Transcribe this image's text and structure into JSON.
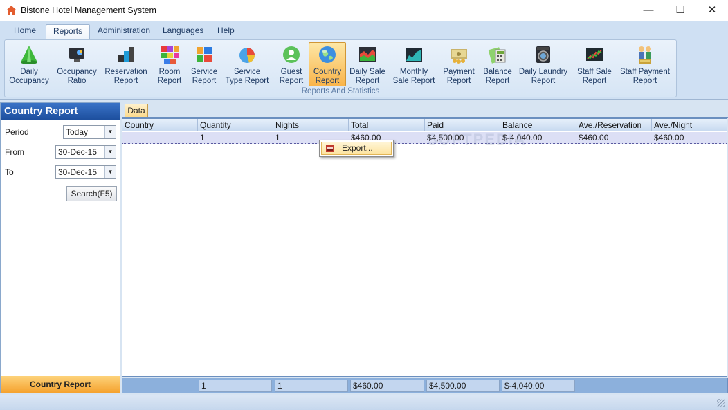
{
  "window": {
    "title": "Bistone Hotel Management System",
    "minimize": "—",
    "maximize": "☐",
    "close": "✕"
  },
  "ribbon": {
    "tabs": [
      {
        "label": "Home"
      },
      {
        "label": "Reports"
      },
      {
        "label": "Administration"
      },
      {
        "label": "Languages"
      },
      {
        "label": "Help"
      }
    ],
    "active_tab": "Reports",
    "group_caption": "Reports And Statistics",
    "buttons": [
      {
        "line1": "Daily",
        "line2": "Occupancy",
        "icon": "green-cone-icon"
      },
      {
        "line1": "Occupancy",
        "line2": "Ratio",
        "icon": "monitor-chart-icon"
      },
      {
        "line1": "Reservation",
        "line2": "Report",
        "icon": "blocks-icon"
      },
      {
        "line1": "Room",
        "line2": "Report",
        "icon": "colored-cubes-icon"
      },
      {
        "line1": "Service",
        "line2": "Report",
        "icon": "service-cubes-icon"
      },
      {
        "line1": "Service",
        "line2": "Type Report",
        "icon": "pie-chart-icon"
      },
      {
        "line1": "Guest",
        "line2": "Report",
        "icon": "guest-icon"
      },
      {
        "line1": "Country",
        "line2": "Report",
        "icon": "globe-icon"
      },
      {
        "line1": "Daily Sale",
        "line2": "Report",
        "icon": "area-chart-icon"
      },
      {
        "line1": "Monthly",
        "line2": "Sale Report",
        "icon": "monthly-chart-icon"
      },
      {
        "line1": "Payment",
        "line2": "Report",
        "icon": "cash-icon"
      },
      {
        "line1": "Balance",
        "line2": "Report",
        "icon": "calculator-icon"
      },
      {
        "line1": "Daily Laundry",
        "line2": "Report",
        "icon": "washer-icon"
      },
      {
        "line1": "Staff Sale",
        "line2": "Report",
        "icon": "stock-chart-icon"
      },
      {
        "line1": "Staff Payment",
        "line2": "Report",
        "icon": "staff-money-icon"
      }
    ]
  },
  "left_panel": {
    "title": "Country Report",
    "period_label": "Period",
    "period_value": "Today",
    "from_label": "From",
    "from_value": "30-Dec-15",
    "to_label": "To",
    "to_value": "30-Dec-15",
    "search_button": "Search(F5)",
    "footer": "Country Report"
  },
  "main": {
    "tab_label": "Data",
    "columns": [
      "Country",
      "Quantity",
      "Nights",
      "Total",
      "Paid",
      "Balance",
      "Ave./Reservation",
      "Ave./Night"
    ],
    "rows": [
      [
        "",
        "1",
        "1",
        "$460.00",
        "$4,500.00",
        "$-4,040.00",
        "$460.00",
        "$460.00"
      ]
    ],
    "footer": [
      "",
      "1",
      "1",
      "$460.00",
      "$4,500.00",
      "$-4,040.00",
      "",
      ""
    ],
    "watermark": "SOFTPEDIA",
    "context_menu": {
      "items": [
        {
          "label": "Export...",
          "icon": "export-icon"
        }
      ]
    }
  },
  "colors": {
    "accent": "#2a5ead",
    "active_button": "#f9b44a",
    "header_bg": "#cfe0f3"
  }
}
